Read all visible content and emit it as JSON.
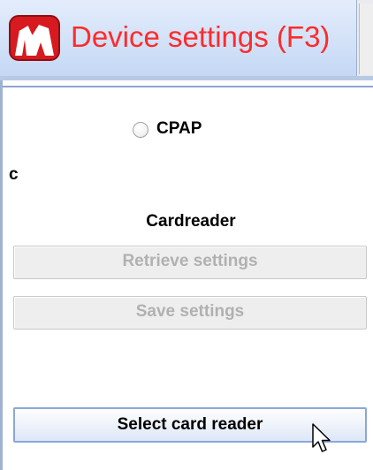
{
  "tab": {
    "icon": "device-logo-icon",
    "label": "Device settings (F3)"
  },
  "options": {
    "radio_label": "CPAP",
    "partial_label": "c"
  },
  "cardreader": {
    "heading": "Cardreader",
    "retrieve_label": "Retrieve settings",
    "save_label": "Save settings",
    "select_label": "Select card reader"
  },
  "colors": {
    "tab_text": "#ff2b2b",
    "tab_background": "#d3e2f8",
    "separator": "#8ea5cc",
    "disabled_text": "#b1b1b1",
    "focused_border": "#8aa7d9"
  },
  "cursor": {
    "icon": "mouse-pointer-icon"
  }
}
